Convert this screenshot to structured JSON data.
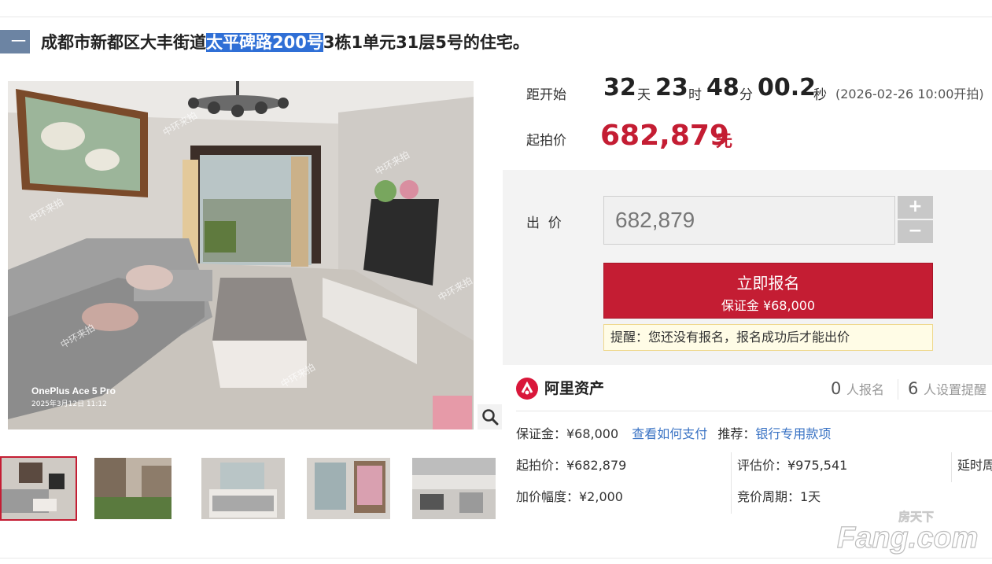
{
  "header": {
    "badge": "一拍",
    "title_before": "成都市新都区大丰街道",
    "title_highlight": "太平碑路200号",
    "title_after": "3栋1单元31层5号的住宅。"
  },
  "photo": {
    "watermark_text": "中环来拍",
    "camera_line1": "OnePlus Ace 5 Pro",
    "camera_line2": "2025年3月12日 11:12"
  },
  "countdown": {
    "label": "距开始",
    "days": "32",
    "days_unit": "天",
    "hours": "23",
    "hours_unit": "时",
    "minutes": "48",
    "minutes_unit": "分",
    "seconds": "00.2",
    "seconds_unit": "秒",
    "start_note": "(2026-02-26 10:00开拍)"
  },
  "start_price": {
    "label": "起拍价",
    "value": "682,879",
    "unit": "元"
  },
  "bid": {
    "label": "出  价",
    "input_value": "682,879",
    "plus": "+",
    "minus": "−",
    "signup_label": "立即报名",
    "deposit_line": "保证金 ¥68,000",
    "tip": "提醒：您还没有报名，报名成功后才能出价"
  },
  "platform": {
    "name": "阿里资产",
    "signups_count": "0",
    "signups_label": "人报名",
    "reminders_count": "6",
    "reminders_label": "人设置提醒"
  },
  "details": {
    "deposit": "保证金：¥68,000",
    "how_to_pay": "查看如何支付",
    "recommend_label": "推荐：",
    "recommend_link": "银行专用款项",
    "start_price": "起拍价：¥682,879",
    "appraisal": "评估价：¥975,541",
    "delay": "延时周期",
    "increment": "加价幅度：¥2,000",
    "bidding_cycle": "竞价周期：1天"
  },
  "site_watermark": {
    "top": "房天下",
    "main": "Fang.com"
  }
}
